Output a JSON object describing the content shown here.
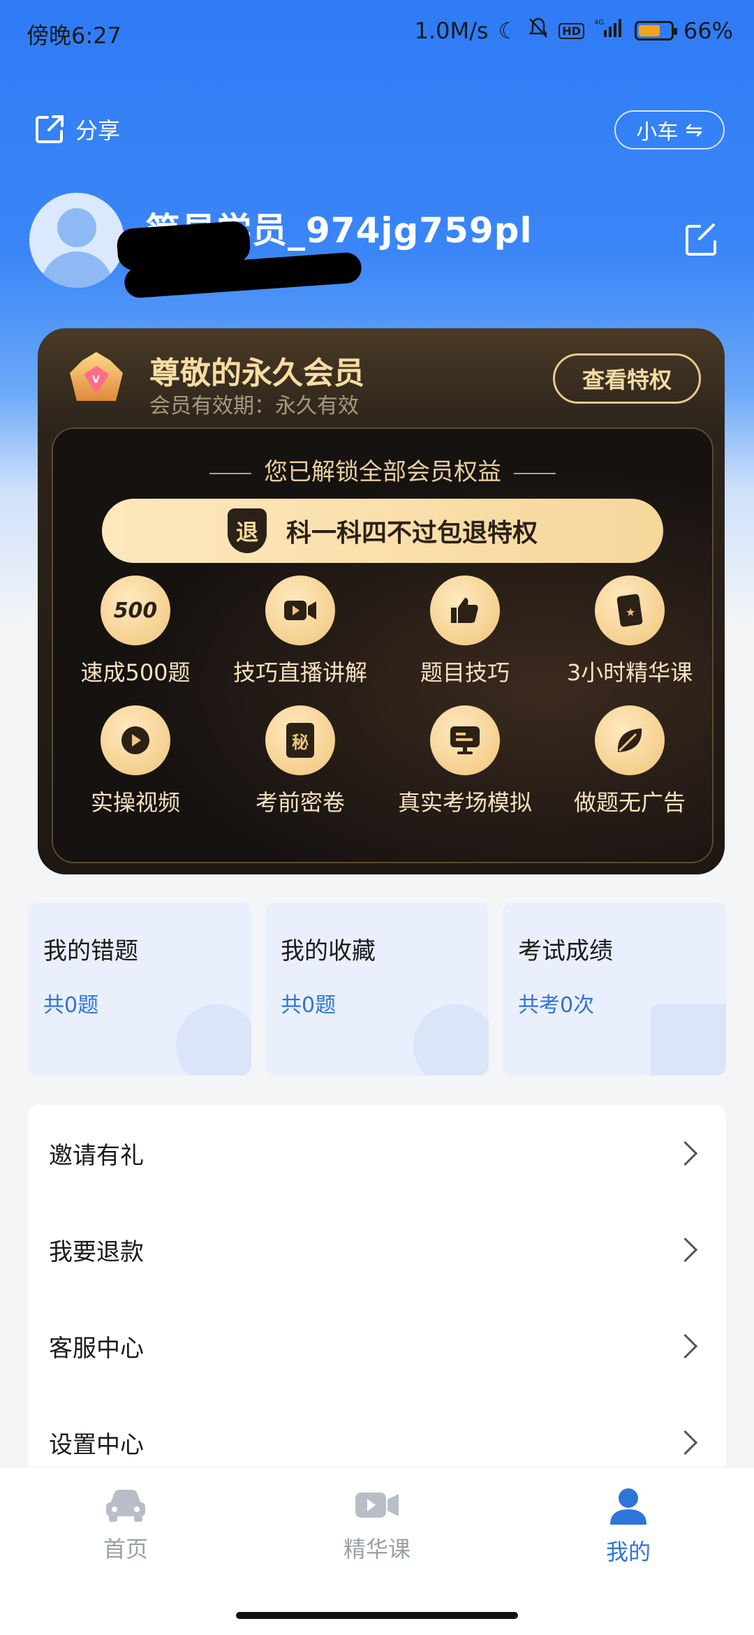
{
  "status_bar": {
    "time": "傍晚6:27",
    "speed": "1.0M/s",
    "battery": "66%",
    "battery_level": 0.66,
    "icons": [
      "moon-icon",
      "bell-off-icon",
      "hd-icon",
      "signal-4g-icon",
      "battery-icon"
    ]
  },
  "header": {
    "share_label": "分享",
    "vehicle_switch_label": "小车"
  },
  "profile": {
    "username": "简易学员_974jg759pl"
  },
  "vip": {
    "title": "尊敬的永久会员",
    "subtitle": "会员有效期：永久有效",
    "view_button": "查看特权",
    "unlock_text": "您已解锁全部会员权益",
    "refund_badge": "退",
    "refund_text": "科一科四不过包退特权",
    "perks": [
      {
        "label": "速成500题",
        "icon": "500-icon",
        "glyph": "500"
      },
      {
        "label": "技巧直播讲解",
        "icon": "video-camera-icon",
        "glyph": "▶"
      },
      {
        "label": "题目技巧",
        "icon": "thumbs-up-icon",
        "glyph": "👍"
      },
      {
        "label": "3小时精华课",
        "icon": "star-card-icon",
        "glyph": "★"
      },
      {
        "label": "实操视频",
        "icon": "play-icon",
        "glyph": "▶"
      },
      {
        "label": "考前密卷",
        "icon": "secret-paper-icon",
        "glyph": "秘"
      },
      {
        "label": "真实考场模拟",
        "icon": "monitor-icon",
        "glyph": "▣"
      },
      {
        "label": "做题无广告",
        "icon": "leaf-icon",
        "glyph": "🍃"
      }
    ]
  },
  "stats": [
    {
      "title": "我的错题",
      "sub": "共0题"
    },
    {
      "title": "我的收藏",
      "sub": "共0题"
    },
    {
      "title": "考试成绩",
      "sub": "共考0次"
    }
  ],
  "menu": [
    {
      "label": "邀请有礼"
    },
    {
      "label": "我要退款"
    },
    {
      "label": "客服中心"
    },
    {
      "label": "设置中心"
    }
  ],
  "tabs": [
    {
      "label": "首页",
      "icon": "car-icon",
      "active": false
    },
    {
      "label": "精华课",
      "icon": "video-icon",
      "active": false
    },
    {
      "label": "我的",
      "icon": "user-icon",
      "active": true
    }
  ],
  "colors": {
    "brand_blue": "#2f7bf6",
    "accent_blue": "#2f74d8",
    "vip_gold": "#f8dca2"
  }
}
